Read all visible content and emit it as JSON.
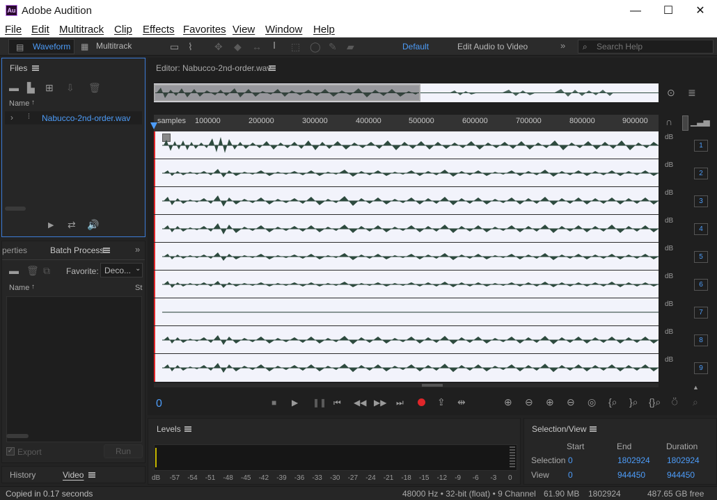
{
  "window": {
    "app_icon": "Au",
    "title": "Adobe Audition",
    "minimize": "—",
    "maximize": "☐",
    "close": "✕"
  },
  "menu": [
    "File",
    "Edit",
    "Multitrack",
    "Clip",
    "Effects",
    "Favorites",
    "View",
    "Window",
    "Help"
  ],
  "toolbar": {
    "waveform": "Waveform",
    "multitrack": "Multitrack",
    "workspace": "Default",
    "edit_video": "Edit Audio to Video",
    "search_placeholder": "Search Help"
  },
  "files_panel": {
    "title": "Files",
    "col_name": "Name",
    "file": "Nabucco-2nd-order.wav"
  },
  "batch_panel": {
    "tab_prev": "perties",
    "title": "Batch Process",
    "favorite_label": "Favorite:",
    "favorite_value": "Deco...",
    "col_name": "Name",
    "col_status": "St",
    "export": "Export",
    "run": "Run"
  },
  "bottom_tabs": {
    "history": "History",
    "video": "Video"
  },
  "editor": {
    "title": "Editor: Nabucco-2nd-order.wav",
    "ruler_unit": "samples",
    "ruler_ticks": [
      "100000",
      "200000",
      "300000",
      "400000",
      "500000",
      "600000",
      "700000",
      "800000",
      "900000"
    ],
    "db": "dB",
    "channels": [
      "1",
      "2",
      "3",
      "4",
      "5",
      "6",
      "7",
      "8",
      "9"
    ],
    "playhead": "0"
  },
  "levels": {
    "title": "Levels",
    "scale": [
      "dB",
      "-57",
      "-54",
      "-51",
      "-48",
      "-45",
      "-42",
      "-39",
      "-36",
      "-33",
      "-30",
      "-27",
      "-24",
      "-21",
      "-18",
      "-15",
      "-12",
      "-9",
      "-6",
      "-3",
      "0"
    ]
  },
  "selection": {
    "title": "Selection/View",
    "headers": [
      "Start",
      "End",
      "Duration"
    ],
    "rows": [
      {
        "label": "Selection",
        "start": "0",
        "end": "1802924",
        "duration": "1802924"
      },
      {
        "label": "View",
        "start": "0",
        "end": "944450",
        "duration": "944450"
      }
    ]
  },
  "status": {
    "message": "Copied in 0.17 seconds",
    "format": "48000 Hz • 32-bit (float) • 9 Channel",
    "size": "61.90 MB",
    "samples": "1802924",
    "free": "487.65 GB free"
  },
  "colors": {
    "accent": "#4d9cf8",
    "wave": "#2d4a3e",
    "record": "#e0262a"
  }
}
